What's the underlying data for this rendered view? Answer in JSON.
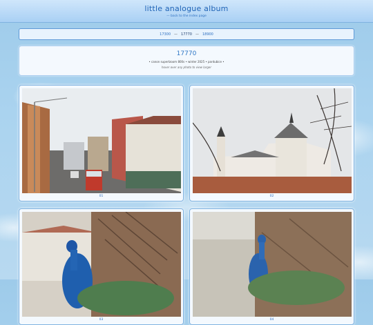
{
  "header": {
    "title": "little analogue album",
    "back_link": "— back to the index page"
  },
  "pager": {
    "prev": "17300",
    "sep1": "—",
    "current": "17770",
    "sep2": "—",
    "next": "18900"
  },
  "album": {
    "number": "17770",
    "meta": "• canon supertzoom 800s • winter 2025 • pardubice •",
    "hint": "hover over any photo to view larger"
  },
  "photos": [
    {
      "caption": "01"
    },
    {
      "caption": "02"
    },
    {
      "caption": "03"
    },
    {
      "caption": "04"
    }
  ],
  "colors": {
    "accent": "#1f63b6",
    "link": "#2d6fc0",
    "card_border": "#7fb2e0"
  }
}
